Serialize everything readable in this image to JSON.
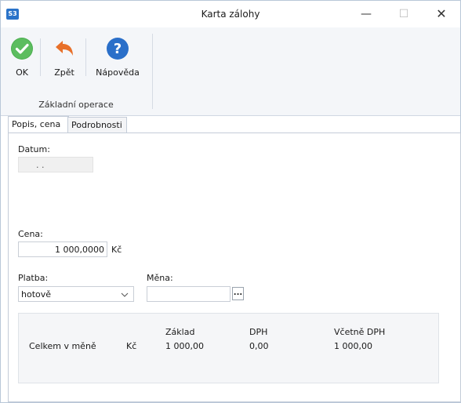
{
  "window": {
    "app_logo": "S3",
    "title": "Karta zálohy",
    "minimize": "—",
    "maximize": "☐",
    "close": "✕"
  },
  "ribbon": {
    "ok_label": "OK",
    "back_label": "Zpět",
    "help_label": "Nápověda",
    "group_label": "Základní operace"
  },
  "tabs": [
    {
      "label": "Popis, cena",
      "active": true
    },
    {
      "label": "Podrobnosti",
      "active": false
    }
  ],
  "form": {
    "datum_label": "Datum:",
    "datum_value": ".   .",
    "cena_label": "Cena:",
    "cena_value": "1 000,0000",
    "currency_unit": "Kč",
    "platba_label": "Platba:",
    "platba_value": "hotově",
    "mena_label": "Měna:",
    "mena_value": "",
    "mena_button": "..."
  },
  "summary": {
    "headers": {
      "zaklad": "Základ",
      "dph": "DPH",
      "vcetne": "Včetně DPH"
    },
    "row_label": "Celkem v měně",
    "row_currency": "Kč",
    "zaklad": "1 000,00",
    "dph": "0,00",
    "vcetne": "1 000,00"
  },
  "colors": {
    "ok_green": "#4caf50",
    "back_orange": "#e8702a",
    "help_blue": "#2a6fc9"
  }
}
